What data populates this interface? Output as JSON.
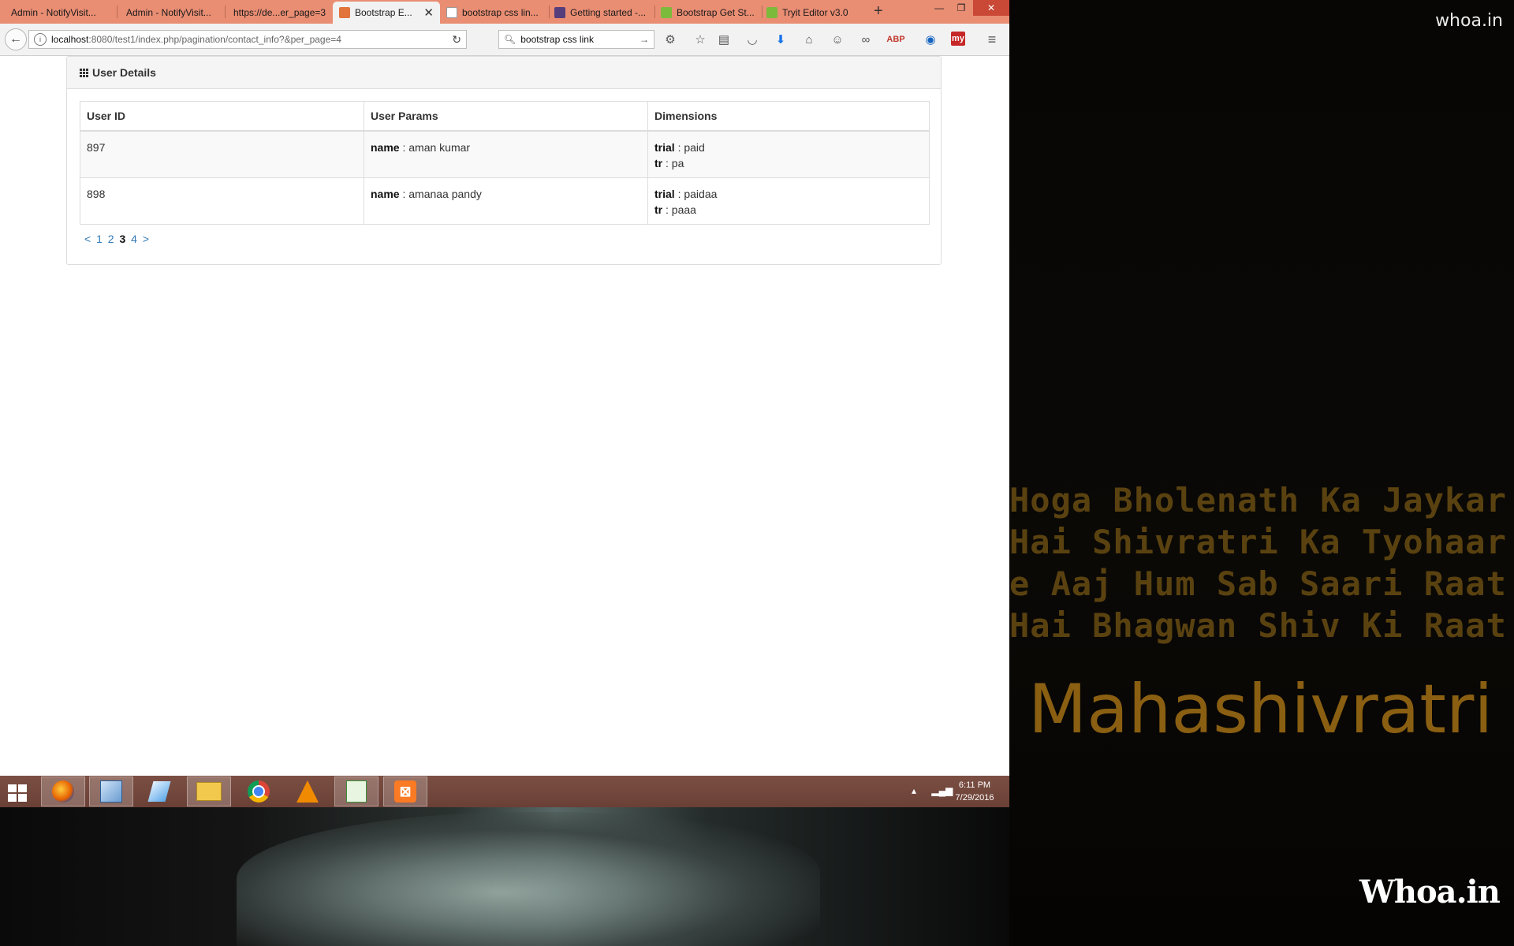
{
  "wallpaper": {
    "watermark_top": "whoa.in",
    "poem_lines": [
      "Hoga Bholenath Ka Jaykar",
      "Hai Shivratri Ka Tyohaar",
      "e Aaj Hum Sab Saari Raat",
      "Hai Bhagwan Shiv Ki Raat"
    ],
    "title": "Mahashivratri",
    "logo": "Whoa.in"
  },
  "browser": {
    "tabs": [
      {
        "label": "Admin - NotifyVisit..."
      },
      {
        "label": "Admin - NotifyVisit..."
      },
      {
        "label": "https://de...er_page=3"
      },
      {
        "label": "Bootstrap E...",
        "active": true
      },
      {
        "label": "bootstrap css lin..."
      },
      {
        "label": "Getting started -..."
      },
      {
        "label": "Bootstrap Get St..."
      },
      {
        "label": "Tryit Editor v3.0"
      }
    ],
    "url_host": "localhost",
    "url_path": ":8080/test1/index.php/pagination/contact_info?&per_page=4",
    "search_value": "bootstrap css link"
  },
  "panel": {
    "title": "User Details",
    "columns": [
      "User ID",
      "User Params",
      "Dimensions"
    ],
    "rows": [
      {
        "id": "897",
        "param_key": "name",
        "param_value": "aman kumar",
        "dims": [
          {
            "key": "trial",
            "value": "paid"
          },
          {
            "key": "tr",
            "value": "pa"
          }
        ]
      },
      {
        "id": "898",
        "param_key": "name",
        "param_value": "amanaa pandy",
        "dims": [
          {
            "key": "trial",
            "value": "paidaa"
          },
          {
            "key": "tr",
            "value": "paaa"
          }
        ]
      }
    ],
    "pagination": {
      "prev": "<",
      "pages": [
        "1",
        "2",
        "3",
        "4"
      ],
      "current": "3",
      "next": ">"
    }
  },
  "taskbar": {
    "time": "6:11 PM",
    "date": "7/29/2016"
  }
}
